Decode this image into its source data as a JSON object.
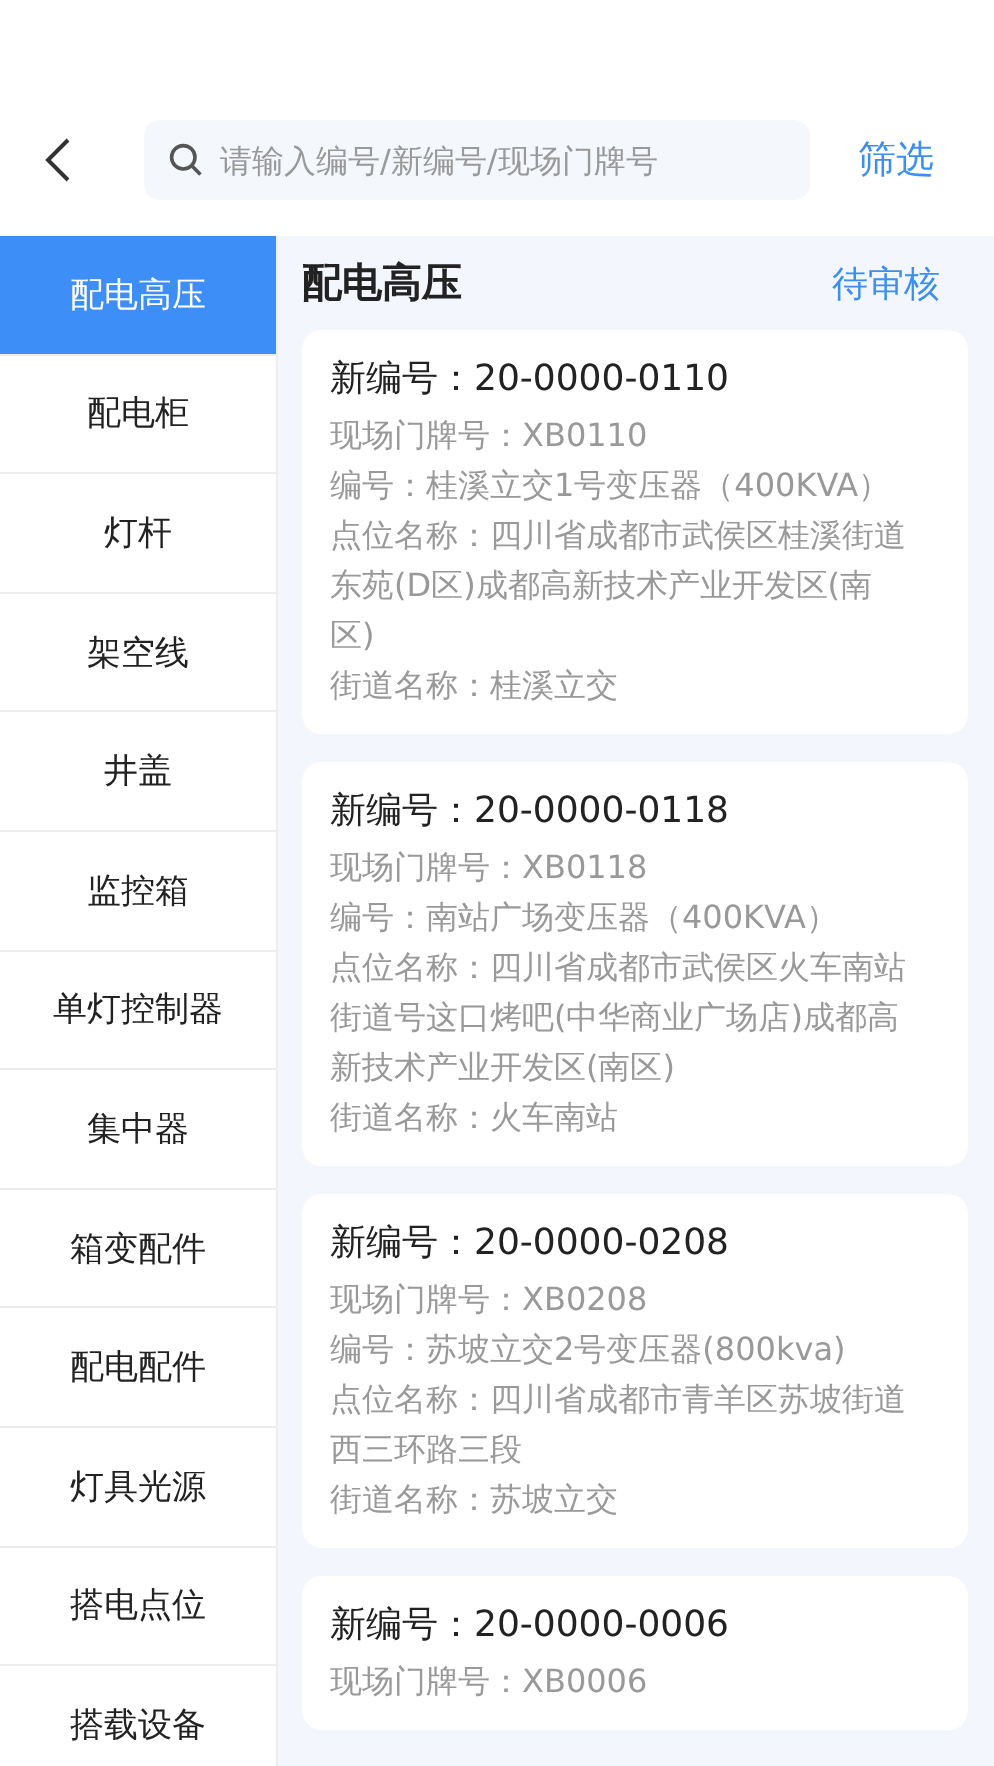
{
  "header": {
    "search_placeholder": "请输入编号/新编号/现场门牌号",
    "filter": "筛选"
  },
  "sidebar": {
    "items": [
      {
        "label": "配电高压",
        "selected": true
      },
      {
        "label": "配电柜",
        "selected": false
      },
      {
        "label": "灯杆",
        "selected": false
      },
      {
        "label": "架空线",
        "selected": false
      },
      {
        "label": "井盖",
        "selected": false
      },
      {
        "label": "监控箱",
        "selected": false
      },
      {
        "label": "单灯控制器",
        "selected": false
      },
      {
        "label": "集中器",
        "selected": false
      },
      {
        "label": "箱变配件",
        "selected": false
      },
      {
        "label": "配电配件",
        "selected": false
      },
      {
        "label": "灯具光源",
        "selected": false
      },
      {
        "label": "搭电点位",
        "selected": false
      },
      {
        "label": "搭载设备",
        "selected": false
      }
    ]
  },
  "content": {
    "title": "配电高压",
    "status": "待审核",
    "cards": [
      {
        "title": "新编号：20-0000-0110",
        "lines": [
          "现场门牌号：XB0110",
          "编号：桂溪立交1号变压器（400KVA）",
          "点位名称：四川省成都市武侯区桂溪街道东苑(D区)成都高新技术产业开发区(南区)",
          "街道名称：桂溪立交"
        ]
      },
      {
        "title": "新编号：20-0000-0118",
        "lines": [
          "现场门牌号：XB0118",
          "编号：南站广场变压器（400KVA）",
          "点位名称：四川省成都市武侯区火车南站街道号这口烤吧(中华商业广场店)成都高新技术产业开发区(南区)",
          "街道名称：火车南站"
        ]
      },
      {
        "title": "新编号：20-0000-0208",
        "lines": [
          "现场门牌号：XB0208",
          "编号：苏坡立交2号变压器(800kva)",
          "点位名称：四川省成都市青羊区苏坡街道西三环路三段",
          "街道名称：苏坡立交"
        ]
      },
      {
        "title": "新编号：20-0000-0006",
        "lines": [
          "现场门牌号：XB0006"
        ]
      }
    ]
  }
}
